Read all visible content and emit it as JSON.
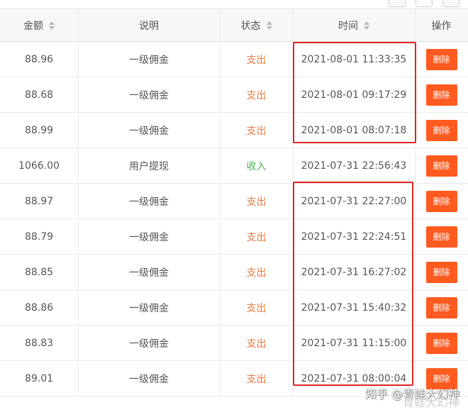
{
  "table": {
    "headers": {
      "amount": "金额",
      "description": "说明",
      "status": "状态",
      "time": "时间",
      "operation": "操作"
    },
    "rows": [
      {
        "amount": "88.96",
        "description": "一级佣金",
        "status": "支出",
        "status_type": "out",
        "time": "2021-08-01 11:33:35",
        "action": "删除"
      },
      {
        "amount": "88.68",
        "description": "一级佣金",
        "status": "支出",
        "status_type": "out",
        "time": "2021-08-01 09:17:29",
        "action": "删除"
      },
      {
        "amount": "88.99",
        "description": "一级佣金",
        "status": "支出",
        "status_type": "out",
        "time": "2021-08-01 08:07:18",
        "action": "删除"
      },
      {
        "amount": "1066.00",
        "description": "用户提现",
        "status": "收入",
        "status_type": "in",
        "time": "2021-07-31 22:56:43",
        "action": "删除"
      },
      {
        "amount": "88.97",
        "description": "一级佣金",
        "status": "支出",
        "status_type": "out",
        "time": "2021-07-31 22:27:00",
        "action": "删除"
      },
      {
        "amount": "88.79",
        "description": "一级佣金",
        "status": "支出",
        "status_type": "out",
        "time": "2021-07-31 22:24:51",
        "action": "删除"
      },
      {
        "amount": "88.85",
        "description": "一级佣金",
        "status": "支出",
        "status_type": "out",
        "time": "2021-07-31 16:27:02",
        "action": "删除"
      },
      {
        "amount": "88.86",
        "description": "一级佣金",
        "status": "支出",
        "status_type": "out",
        "time": "2021-07-31 15:40:32",
        "action": "删除"
      },
      {
        "amount": "88.83",
        "description": "一级佣金",
        "status": "支出",
        "status_type": "out",
        "time": "2021-07-31 11:15:00",
        "action": "删除"
      },
      {
        "amount": "89.01",
        "description": "一级佣金",
        "status": "支出",
        "status_type": "out",
        "time": "2021-07-31 08:00:04",
        "action": "删除"
      }
    ]
  },
  "watermark": {
    "text": "知乎 @青蛙大幻神",
    "bottom_text": "青蛙大幻神"
  },
  "colors": {
    "status_out": "#e8793a",
    "status_in": "#4caf50",
    "delete_button": "#ff5a1f",
    "highlight_border": "#e02424"
  },
  "icons": {
    "sort": "sort-icon",
    "toolbar_left": "toolbar-icon-grid",
    "toolbar_mid": "toolbar-icon-print",
    "toolbar_right": "toolbar-icon-export"
  }
}
